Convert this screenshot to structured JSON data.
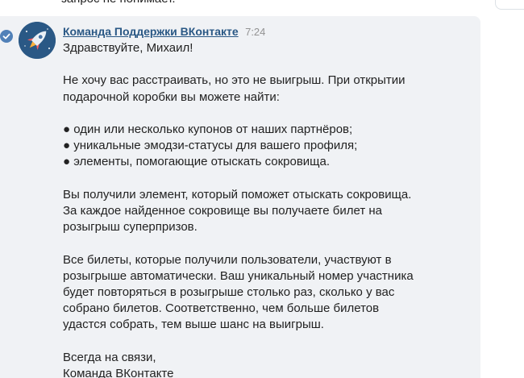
{
  "prev_message": {
    "text": "запрос не понимает."
  },
  "message": {
    "sender": "Команда Поддержки ВКонтакте",
    "time": "7:24",
    "lines": [
      "Здравствуйте, Михаил!",
      "",
      "Не хочу вас расстраивать, но это не выигрыш. При открытии",
      "подарочной коробки вы можете найти:",
      "",
      "● один или несколько купонов от наших партнёров;",
      "● уникальные эмодзи-статусы для вашего профиля;",
      "● элементы, помогающие отыскать сокровища.",
      "",
      "Вы получили элемент, который поможет отыскать сокровища.",
      "За каждое найденное сокровище вы получаете билет на",
      "розыгрыш суперпризов.",
      "",
      "Все билеты, которые получили пользователи, участвуют в",
      "розыгрыше автоматически. Ваш уникальный номер участника",
      "будет повторяться в розыгрыше столько раз, сколько у вас",
      "собрано билетов. Соответственно, чем больше билетов",
      "удастся собрать, тем выше шанс на выигрыш.",
      "",
      "Всегда на связи,",
      "Команда ВКонтакте"
    ]
  },
  "icons": {
    "verified": "verified-check-icon",
    "avatar": "rocket-avatar-icon"
  },
  "colors": {
    "link": "#2a5885",
    "text": "#222222",
    "time": "#939393",
    "highlight": "#f0f2f5",
    "verified": "#5181b8"
  }
}
